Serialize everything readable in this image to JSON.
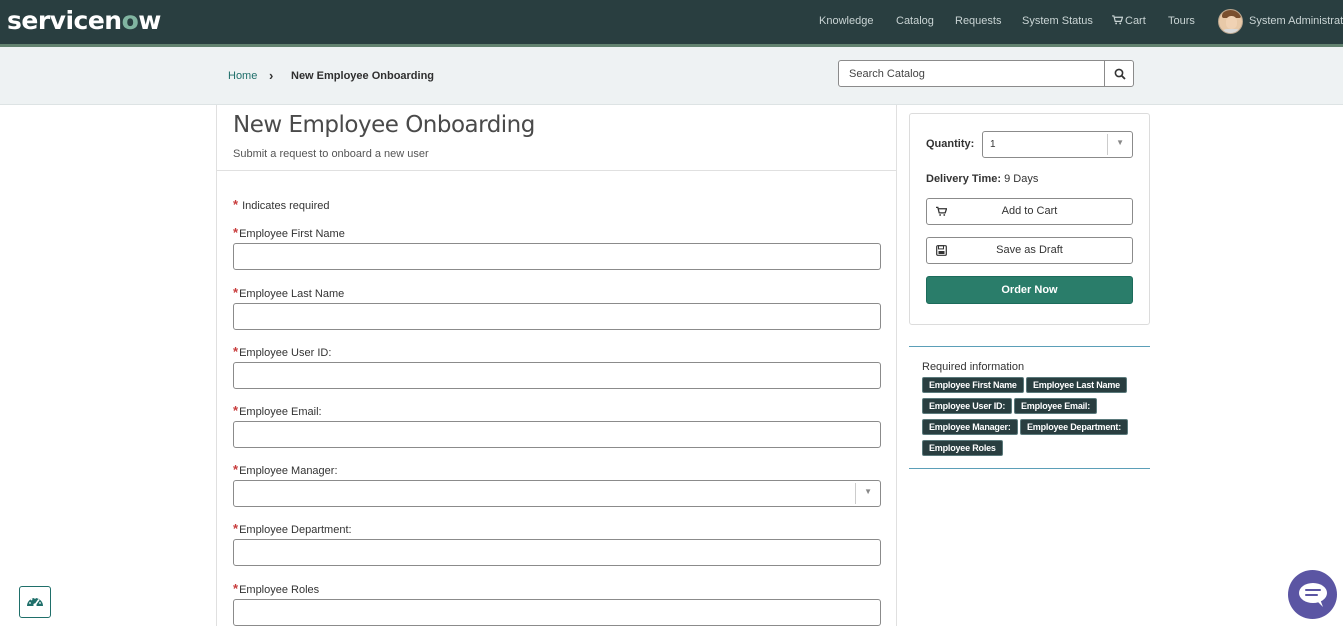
{
  "app": {
    "logo_text_1": "servicen",
    "logo_text_2": "o",
    "logo_text_3": "w"
  },
  "nav": {
    "knowledge": "Knowledge",
    "catalog": "Catalog",
    "requests": "Requests",
    "system_status": "System Status",
    "cart": "Cart",
    "tours": "Tours",
    "user_name": "System Administrator"
  },
  "breadcrumb": {
    "home": "Home",
    "current": "New Employee Onboarding"
  },
  "search": {
    "placeholder": "Search Catalog"
  },
  "form": {
    "title": "New Employee Onboarding",
    "subtitle": "Submit a request to onboard a new user",
    "required_note": "Indicates required",
    "fields": [
      {
        "label": "Employee First Name",
        "value": ""
      },
      {
        "label": "Employee Last Name",
        "value": ""
      },
      {
        "label": "Employee User ID:",
        "value": ""
      },
      {
        "label": "Employee Email:",
        "value": ""
      },
      {
        "label": "Employee Manager:",
        "value": ""
      },
      {
        "label": "Employee Department:",
        "value": ""
      },
      {
        "label": "Employee Roles",
        "value": ""
      }
    ]
  },
  "order": {
    "quantity_label": "Quantity:",
    "quantity_value": "1",
    "delivery_label": "Delivery Time:",
    "delivery_value": "9 Days",
    "add_to_cart": "Add to Cart",
    "save_draft": "Save as Draft",
    "order_now": "Order Now"
  },
  "required_info": {
    "title": "Required information",
    "tags": [
      "Employee First Name",
      "Employee Last Name",
      "Employee User ID:",
      "Employee Email:",
      "Employee Manager:",
      "Employee Department:",
      "Employee Roles"
    ]
  },
  "colors": {
    "header_bg": "#293e40",
    "accent": "#2a7d6a",
    "required": "#c83c3c",
    "chat": "#5b55a3"
  }
}
